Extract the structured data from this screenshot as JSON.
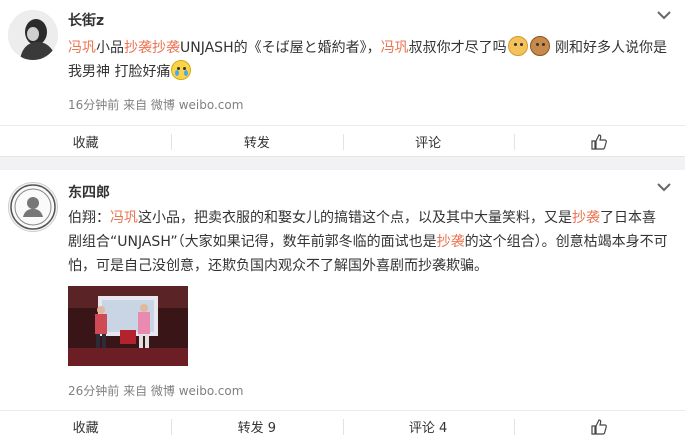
{
  "posts": [
    {
      "username": "长街z",
      "text_segments": [
        {
          "text": "冯巩",
          "hl": true
        },
        {
          "text": "小品",
          "hl": false
        },
        {
          "text": "抄袭抄袭",
          "hl": true
        },
        {
          "text": "UNJASH的《そば屋と婚約者》，",
          "hl": false
        },
        {
          "text": "冯巩",
          "hl": true
        },
        {
          "text": "叔叔你才尽了吗",
          "hl": false
        }
      ],
      "text_after_emoji": "刚和好多人说你是我男神 打脸好痛",
      "meta": "16分钟前 来自 微博 weibo.com",
      "actions": {
        "collect": "收藏",
        "repost": "转发",
        "comment": "评论"
      }
    },
    {
      "username": "东四郎",
      "text_segments": [
        {
          "text": "伯翔：",
          "hl": false
        },
        {
          "text": "冯巩",
          "hl": true
        },
        {
          "text": "这小品，把卖衣服的和娶女儿的搞错这个点，以及其中大量笑料，又是",
          "hl": false
        },
        {
          "text": "抄袭",
          "hl": true
        },
        {
          "text": "了日本喜剧组合“UNJASH”（大家如果记得，数年前郭冬临的面试也是",
          "hl": false
        },
        {
          "text": "抄袭",
          "hl": true
        },
        {
          "text": "的这个组合）。创意枯竭本身不可怕，可是自己没创意，还欺负国内观众不了解国外喜剧而抄袭欺骗。",
          "hl": false
        }
      ],
      "meta": "26分钟前 来自 微博 weibo.com",
      "actions": {
        "collect": "收藏",
        "repost": "转发 9",
        "comment": "评论 4"
      }
    }
  ],
  "colors": {
    "highlight": "#eb7350",
    "divider": "#f2f2f5",
    "meta": "#808080"
  }
}
